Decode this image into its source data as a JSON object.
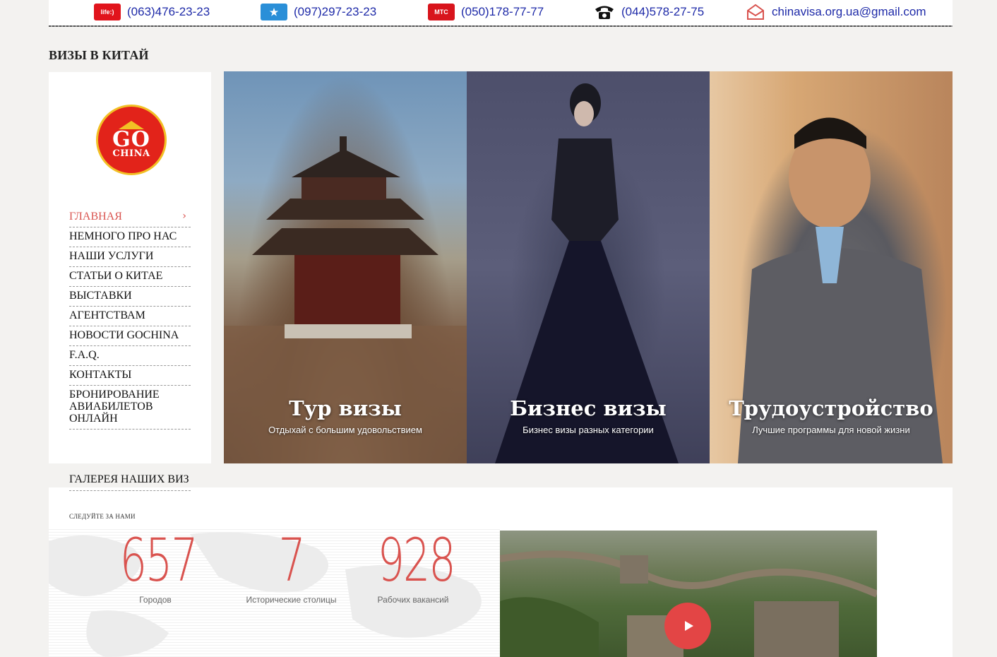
{
  "contacts": [
    {
      "operator": "life:)",
      "value": "(063)476-23-23"
    },
    {
      "operator": "★",
      "value": "(097)297-23-23"
    },
    {
      "operator": "МТС",
      "value": "(050)178-77-77"
    },
    {
      "operator": "☎",
      "value": "(044)578-27-75"
    },
    {
      "operator": "✉",
      "value": "chinavisa.org.ua@gmail.com"
    }
  ],
  "page_title": "ВИЗЫ В КИТАЙ",
  "logo": {
    "top": "GO",
    "bottom": "CHINA"
  },
  "nav": {
    "items": [
      "ГЛАВНАЯ",
      "НЕМНОГО ПРО НАС",
      "НАШИ УСЛУГИ",
      "СТАТЬИ О КИТАЕ",
      "ВЫСТАВКИ",
      "АГЕНТСТВАМ",
      "НОВОСТИ GOCHINA",
      "F.A.Q.",
      "КОНТАКТЫ",
      "БРОНИРОВАНИЕ АВИАБИЛЕТОВ ОНЛАЙН",
      "ГАЛЕРЕЯ НАШИХ ВИЗ"
    ],
    "active_chevron": "›"
  },
  "hero": [
    {
      "title": "Тур визы",
      "subtitle": "Отдыхай с большим удовольствием"
    },
    {
      "title": "Бизнес визы",
      "subtitle": "Бизнес визы разных категории"
    },
    {
      "title": "Трудоустройство",
      "subtitle": "Лучшие программы для новой жизни"
    }
  ],
  "follow_label": "СЛЕДУЙТЕ ЗА НАМИ",
  "stats": [
    {
      "value": "657",
      "label": "Городов"
    },
    {
      "value": "7",
      "label": "Исторические столицы"
    },
    {
      "value": "928",
      "label": "Рабочих вакансий"
    }
  ],
  "colors": {
    "accent": "#d9534f",
    "link": "#1e2aa8"
  }
}
